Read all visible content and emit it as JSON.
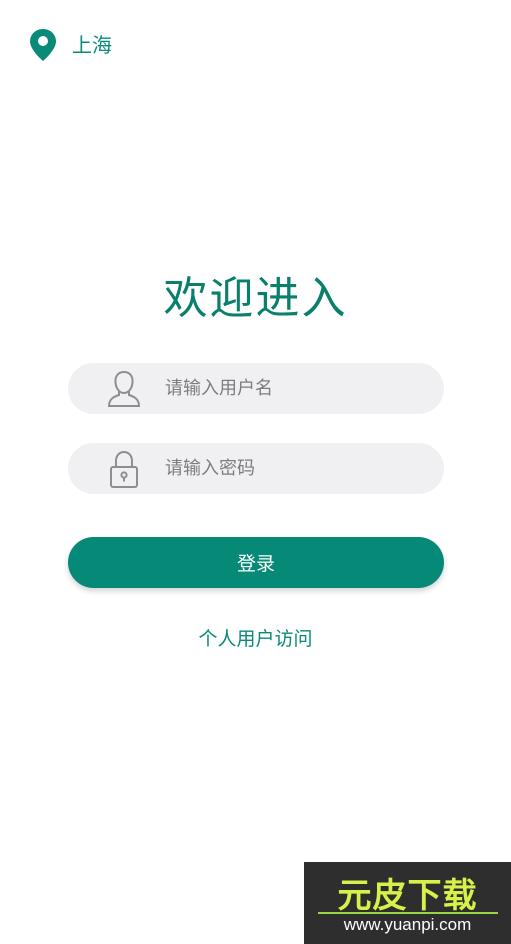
{
  "header": {
    "location_icon": "map-pin-icon",
    "city": "上海"
  },
  "main": {
    "title": "欢迎进入",
    "username_field": {
      "icon": "user-icon",
      "placeholder": "请输入用户名",
      "value": ""
    },
    "password_field": {
      "icon": "lock-icon",
      "placeholder": "请输入密码",
      "value": ""
    },
    "login_button": "登录",
    "personal_access_link": "个人用户访问"
  },
  "watermark": {
    "logo_text": "元皮下载",
    "url": "www.yuanpi.com"
  },
  "colors": {
    "accent": "#068a77",
    "input_bg": "#f0f0f3",
    "background": "#ffffff"
  }
}
